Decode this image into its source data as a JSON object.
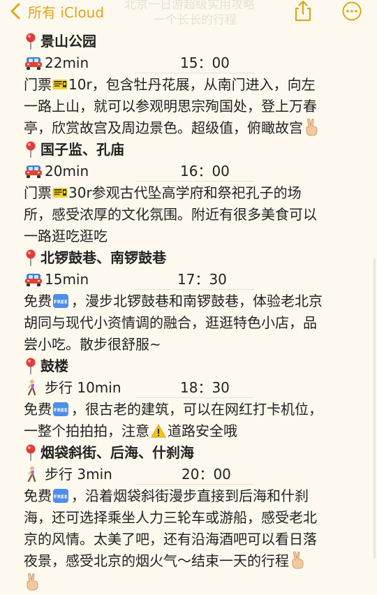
{
  "topbar": {
    "back_label": "所有 iCloud",
    "ghost_line1": "北京一日游超级实用攻略",
    "ghost_line2": "一个长长的行程"
  },
  "colors": {
    "accent": "#e0a51a",
    "background": "#fdf9ee",
    "text": "#222222",
    "pin": "#e23b3b"
  },
  "icons": {
    "back": "chevron-left-icon",
    "share": "share-icon",
    "more": "more-icon",
    "pin": "round-pushpin-icon",
    "car": "car-icon",
    "walk": "walking-person-icon",
    "ticket": "admission-ticket-icon",
    "free": "free-button-icon",
    "warning": "warning-icon",
    "victory": "victory-hand-icon"
  },
  "stops": [
    {
      "name": "景山公园",
      "travel": "22min",
      "time": "15：00",
      "lines": [
        {
          "pre": "门票",
          "icon": "ticket",
          "post": "10r，包含牡丹花展，从南门进入，向左"
        },
        {
          "pre": "一路上山，就可以参观明思宗殉国处，登上万春"
        },
        {
          "pre": "亭，欣赏故宫及周边景色。超级值，俯瞰故宫",
          "icon_end": "victory"
        }
      ]
    },
    {
      "name": "国子监、孔庙",
      "travel": "20min",
      "time": "16：00",
      "lines": [
        {
          "pre": "门票",
          "icon": "ticket",
          "post": "30r参观古代坠高学府和祭祀孔子的场"
        },
        {
          "pre": "所，感受浓厚的文化氛围。附近有很多美食可以"
        },
        {
          "pre": "一路逛吃逛吃"
        }
      ]
    },
    {
      "name": "北锣鼓巷、南锣鼓巷",
      "travel": "15min",
      "time": "17：30",
      "lines": [
        {
          "pre": "免费",
          "icon": "free",
          "post": "，漫步北锣鼓巷和南锣鼓巷，体验老北京"
        },
        {
          "pre": "胡同与现代小资情调的融合，逛逛特色小店，品"
        },
        {
          "pre": "尝小吃。散步很舒服~"
        }
      ]
    },
    {
      "name": "鼓楼",
      "travel": "步行 10min",
      "time": "18：30",
      "lines": [
        {
          "pre": "免费",
          "icon": "free",
          "post": "，很古老的建筑，可以在网红打卡机位，"
        },
        {
          "pre": "一整个拍拍拍，注意",
          "icon": "warning",
          "post": "道路安全哦"
        }
      ]
    },
    {
      "name": "烟袋斜街、后海、什刹海",
      "travel": "步行 3min",
      "time": "20：00",
      "lines": [
        {
          "pre": "免费",
          "icon": "free",
          "post": "，沿着烟袋斜街漫步直接到后海和什刹"
        },
        {
          "pre": "海，还可选择乘坐人力三轮车或游船，感受老北"
        },
        {
          "pre": "京的风情。太美了吧，还有沿海酒吧可以看日落"
        },
        {
          "pre": "夜景，感受北京的烟火气～结束一天的行程",
          "icon_end": "victory"
        },
        {
          "pre": "",
          "icon_end": "victory"
        }
      ]
    }
  ]
}
